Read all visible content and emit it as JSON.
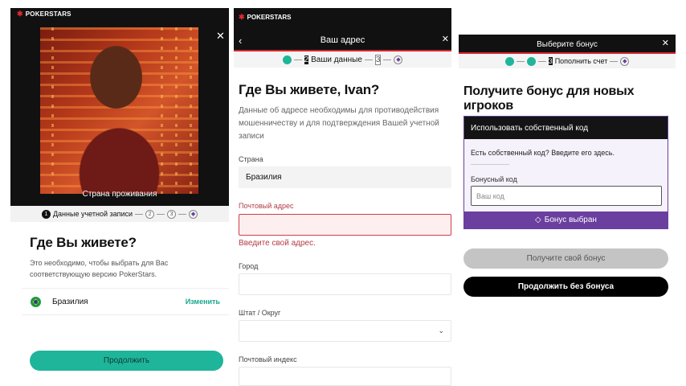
{
  "panel1": {
    "brand": "POKERSTARS",
    "hero_caption": "Страна проживания",
    "steps": {
      "step1_num": "1",
      "step1_label": "Данные учетной записи",
      "step2_num": "2",
      "step3_num": "3"
    },
    "title": "Где Вы живете?",
    "subtitle": "Это необходимо, чтобы выбрать для Вас соответствующую версию PokerStars.",
    "country": "Бразилия",
    "change_link": "Изменить",
    "continue_button": "Продолжить"
  },
  "panel2": {
    "brand": "POKERSTARS",
    "header_title": "Ваш адрес",
    "steps": {
      "step2_num": "2",
      "step2_label": "Ваши данные",
      "step3_num": "3"
    },
    "title": "Где Вы живете, Ivan?",
    "description": "Данные об адресе необходимы для противодействия мошенничеству и для подтверждения Вашей учетной записи",
    "fields": {
      "country_label": "Страна",
      "country_value": "Бразилия",
      "email_label": "Почтовый адрес",
      "email_value": "",
      "email_error": "Введите свой адрес.",
      "city_label": "Город",
      "city_value": "",
      "state_label": "Штат / Округ",
      "state_value": "",
      "zip_label": "Почтовый индекс",
      "zip_value": ""
    }
  },
  "panel3": {
    "header_title": "Выберите бонус",
    "steps": {
      "step3_num": "3",
      "step3_label": "Пополнить счет"
    },
    "title": "Получите бонус для новых игроков",
    "bonus_card": {
      "header": "Использовать собственный код",
      "question": "Есть собственный код? Введите его здесь.",
      "code_label": "Бонусный код",
      "code_placeholder": "Ваш код",
      "selected_label": "Бонус выбран"
    },
    "get_bonus_button": "Получите свой бонус",
    "continue_without_button": "Продолжить без бонуса"
  },
  "colors": {
    "brand_red": "#d6262b",
    "accent_teal": "#1fb59a",
    "bonus_purple": "#6a3fa0",
    "error_red": "#b33c46"
  },
  "icons": [
    "pokerstars-logo-icon",
    "close-icon",
    "back-arrow-icon",
    "check-icon",
    "diamond-icon",
    "chevron-down-icon",
    "brazil-flag-icon"
  ]
}
